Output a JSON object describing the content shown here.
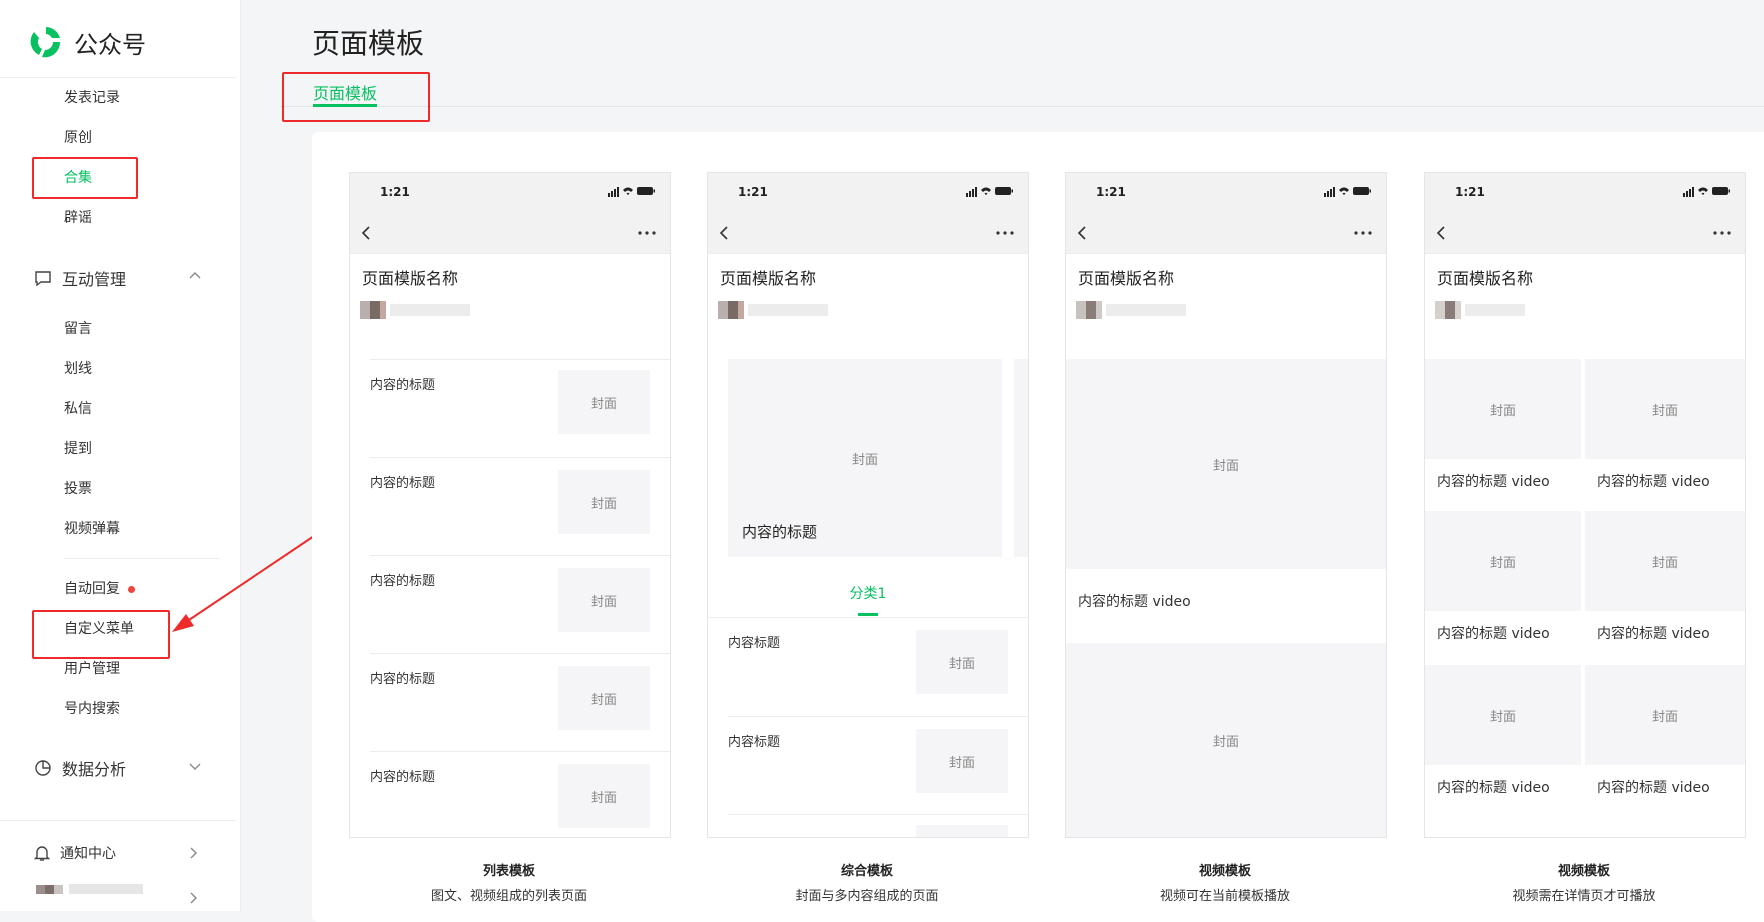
{
  "app": {
    "name": "公众号"
  },
  "colors": {
    "accent": "#07c160",
    "highlight": "#ee2a2a",
    "badge": "#f0453a"
  },
  "sidebar": {
    "items_top": [
      {
        "label": "发表记录",
        "active": false
      },
      {
        "label": "原创",
        "active": false
      },
      {
        "label": "合集",
        "active": true
      },
      {
        "label": "辟谣",
        "active": false
      }
    ],
    "group_interaction": {
      "label": "互动管理",
      "icon": "message-icon",
      "expanded": true
    },
    "items_interaction": [
      {
        "label": "留言"
      },
      {
        "label": "划线"
      },
      {
        "label": "私信"
      },
      {
        "label": "提到"
      },
      {
        "label": "投票"
      },
      {
        "label": "视频弹幕"
      }
    ],
    "items_user": [
      {
        "label": "自动回复"
      },
      {
        "label": "自定义菜单"
      },
      {
        "label": "用户管理"
      },
      {
        "label": "号内搜索"
      }
    ],
    "group_analytics": {
      "label": "数据分析",
      "icon": "pie-chart-icon"
    },
    "notice": {
      "label": "通知中心",
      "icon": "bell-icon"
    }
  },
  "header": {
    "title": "页面模板",
    "tabs": [
      {
        "label": "页面模板",
        "active": true
      }
    ]
  },
  "templates": [
    {
      "status_time": "1:21",
      "page_name": "页面模版名称",
      "items": [
        {
          "title": "内容的标题",
          "cover": "封面"
        },
        {
          "title": "内容的标题",
          "cover": "封面"
        },
        {
          "title": "内容的标题",
          "cover": "封面"
        },
        {
          "title": "内容的标题",
          "cover": "封面"
        },
        {
          "title": "内容的标题",
          "cover": "封面"
        }
      ],
      "caption_title": "列表模板",
      "caption_desc": "图文、视频组成的列表页面"
    },
    {
      "status_time": "1:21",
      "page_name": "页面模版名称",
      "hero_cover": "封面",
      "hero_title": "内容的标题",
      "category_tab": "分类1",
      "items": [
        {
          "title": "内容标题",
          "cover": "封面"
        },
        {
          "title": "内容标题",
          "cover": "封面"
        }
      ],
      "caption_title": "综合模板",
      "caption_desc": "封面与多内容组成的页面"
    },
    {
      "status_time": "1:21",
      "page_name": "页面模版名称",
      "video_cover": "封面",
      "video_title": "内容的标题 video",
      "video_cover_2": "封面",
      "caption_title": "视频模板",
      "caption_desc": "视频可在当前模板播放"
    },
    {
      "status_time": "1:21",
      "page_name": "页面模版名称",
      "cells": [
        {
          "cover": "封面",
          "title": "内容的标题 video"
        },
        {
          "cover": "封面",
          "title": "内容的标题 video"
        },
        {
          "cover": "封面",
          "title": "内容的标题 video"
        },
        {
          "cover": "封面",
          "title": "内容的标题 video"
        },
        {
          "cover": "封面",
          "title": "内容的标题 video"
        },
        {
          "cover": "封面",
          "title": "内容的标题 video"
        }
      ],
      "caption_title": "视频模板",
      "caption_desc": "视频需在详情页才可播放"
    }
  ]
}
